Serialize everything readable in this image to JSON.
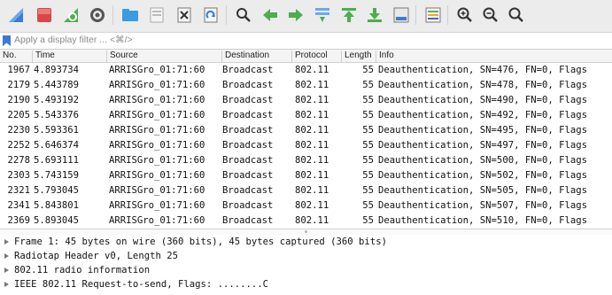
{
  "toolbar": {
    "buttons": [
      {
        "name": "start-capture-icon"
      },
      {
        "name": "stop-capture-icon"
      },
      {
        "name": "restart-capture-icon"
      },
      {
        "name": "capture-options-icon"
      },
      {
        "name": "open-file-icon"
      },
      {
        "name": "save-file-icon"
      },
      {
        "name": "close-file-icon"
      },
      {
        "name": "reload-file-icon"
      },
      {
        "name": "find-packet-icon"
      },
      {
        "name": "go-back-icon"
      },
      {
        "name": "go-forward-icon"
      },
      {
        "name": "go-to-packet-icon"
      },
      {
        "name": "go-first-packet-icon"
      },
      {
        "name": "go-last-packet-icon"
      },
      {
        "name": "autoscroll-icon"
      },
      {
        "name": "colorize-icon"
      },
      {
        "name": "zoom-in-icon"
      },
      {
        "name": "zoom-out-icon"
      },
      {
        "name": "normal-size-icon"
      }
    ]
  },
  "filter": {
    "placeholder": "Apply a display filter ... <⌘/>"
  },
  "packet_list": {
    "columns": [
      "No.",
      "Time",
      "Source",
      "Destination",
      "Protocol",
      "Length",
      "Info"
    ],
    "rows": [
      {
        "no": "1967",
        "time": "4.893734",
        "source": "ARRISGro_01:71:60",
        "destination": "Broadcast",
        "protocol": "802.11",
        "length": "55",
        "info": "Deauthentication, SN=476, FN=0, Flags"
      },
      {
        "no": "2179",
        "time": "5.443789",
        "source": "ARRISGro_01:71:60",
        "destination": "Broadcast",
        "protocol": "802.11",
        "length": "55",
        "info": "Deauthentication, SN=478, FN=0, Flags"
      },
      {
        "no": "2190",
        "time": "5.493192",
        "source": "ARRISGro_01:71:60",
        "destination": "Broadcast",
        "protocol": "802.11",
        "length": "55",
        "info": "Deauthentication, SN=490, FN=0, Flags"
      },
      {
        "no": "2205",
        "time": "5.543376",
        "source": "ARRISGro_01:71:60",
        "destination": "Broadcast",
        "protocol": "802.11",
        "length": "55",
        "info": "Deauthentication, SN=492, FN=0, Flags"
      },
      {
        "no": "2230",
        "time": "5.593361",
        "source": "ARRISGro_01:71:60",
        "destination": "Broadcast",
        "protocol": "802.11",
        "length": "55",
        "info": "Deauthentication, SN=495, FN=0, Flags"
      },
      {
        "no": "2252",
        "time": "5.646374",
        "source": "ARRISGro_01:71:60",
        "destination": "Broadcast",
        "protocol": "802.11",
        "length": "55",
        "info": "Deauthentication, SN=497, FN=0, Flags"
      },
      {
        "no": "2278",
        "time": "5.693111",
        "source": "ARRISGro_01:71:60",
        "destination": "Broadcast",
        "protocol": "802.11",
        "length": "55",
        "info": "Deauthentication, SN=500, FN=0, Flags"
      },
      {
        "no": "2303",
        "time": "5.743159",
        "source": "ARRISGro_01:71:60",
        "destination": "Broadcast",
        "protocol": "802.11",
        "length": "55",
        "info": "Deauthentication, SN=502, FN=0, Flags"
      },
      {
        "no": "2321",
        "time": "5.793045",
        "source": "ARRISGro_01:71:60",
        "destination": "Broadcast",
        "protocol": "802.11",
        "length": "55",
        "info": "Deauthentication, SN=505, FN=0, Flags"
      },
      {
        "no": "2341",
        "time": "5.843801",
        "source": "ARRISGro_01:71:60",
        "destination": "Broadcast",
        "protocol": "802.11",
        "length": "55",
        "info": "Deauthentication, SN=507, FN=0, Flags"
      },
      {
        "no": "2369",
        "time": "5.893045",
        "source": "ARRISGro_01:71:60",
        "destination": "Broadcast",
        "protocol": "802.11",
        "length": "55",
        "info": "Deauthentication, SN=510, FN=0, Flags"
      }
    ]
  },
  "details": {
    "items": [
      "Frame 1: 45 bytes on wire (360 bits), 45 bytes captured (360 bits)",
      "Radiotap Header v0, Length 25",
      "802.11 radio information",
      "IEEE 802.11 Request-to-send, Flags: ........C"
    ]
  }
}
